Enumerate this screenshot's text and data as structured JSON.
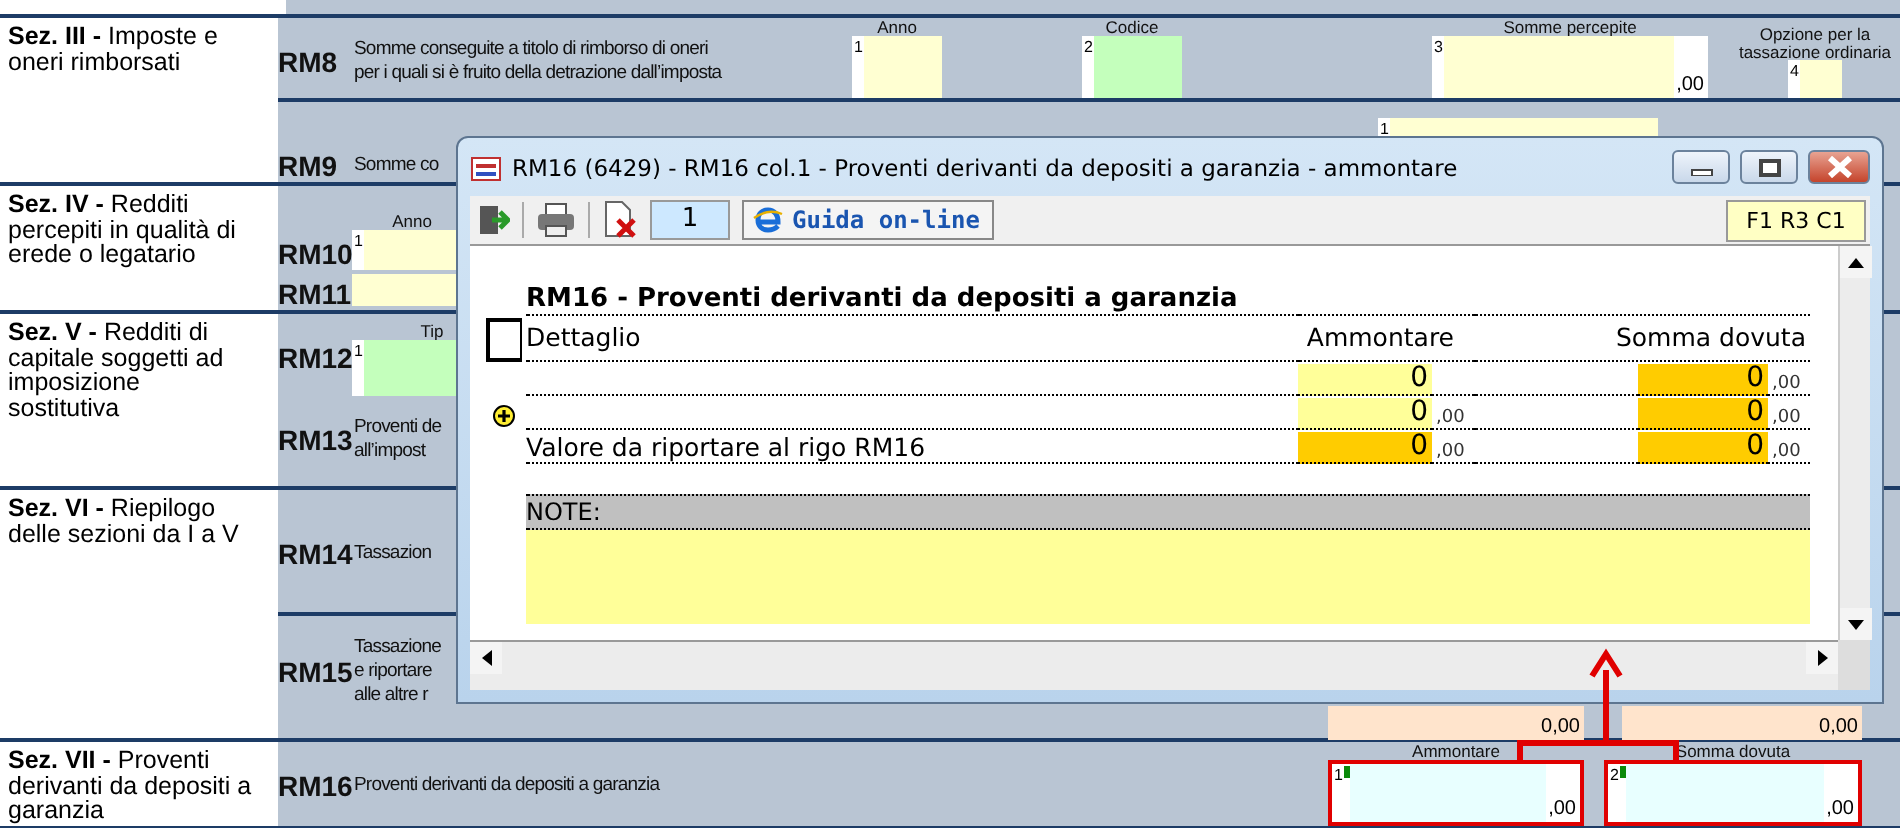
{
  "sections": [
    {
      "label": "**Sez. III -** Imposte e oneri rimborsati",
      "rows": [
        {
          "code": "RM8",
          "description": [
            "Somme conseguite a titolo di rimborso di oneri",
            "per i quali si è fruito della detrazione dall’imposta"
          ],
          "fields": [
            {
              "label": "Anno",
              "number": "1",
              "color": "#ffffd2"
            },
            {
              "label": "Codice",
              "number": "2",
              "color": "#c4ffbc"
            },
            {
              "label": "Somme percepite",
              "number": "3",
              "color": "#ffffd2",
              "decimals": ",00"
            },
            {
              "label": "Opzione per la tassazione ordinaria",
              "number": "4",
              "color": "#ffffd2"
            }
          ]
        },
        {
          "code": "RM9",
          "description": [
            "Somme co"
          ],
          "fields": [
            {
              "number": "1",
              "color": "#ffffd2"
            }
          ]
        }
      ]
    },
    {
      "label": "**Sez. IV -** Redditi percepiti in qualità di erede o legatario",
      "rows": [
        {
          "code": "RM10",
          "fields": [
            {
              "label": "Anno",
              "number": "1",
              "color": "#ffffd2"
            }
          ]
        },
        {
          "code": "RM11",
          "fields": [
            {
              "color": "#ffffd2"
            }
          ]
        }
      ]
    },
    {
      "label": "**Sez. V -** Redditi di capitale soggetti ad imposizione sostitutiva",
      "rows": [
        {
          "code": "RM12",
          "fields": [
            {
              "label": "Tip",
              "number": "1",
              "color": "#c4ffbc"
            }
          ]
        },
        {
          "code": "RM13",
          "description": [
            "Proventi de",
            "all’impost"
          ]
        }
      ]
    },
    {
      "label": "**Sez. VI -** Riepilogo delle sezioni da I a V",
      "rows": [
        {
          "code": "RM14",
          "description": [
            "Tassazion"
          ]
        },
        {
          "code": "RM15",
          "description": [
            "Tassazione",
            "e riportare",
            "alle altre r"
          ],
          "fields": [
            {
              "color": "#ffe4cc",
              "value": "0,00"
            },
            {
              "color": "#ffe4cc",
              "value": "0,00"
            }
          ]
        }
      ]
    },
    {
      "label": "**Sez. VII -** Proventi derivanti da depositi a garanzia",
      "rows": [
        {
          "code": "RM16",
          "description": [
            "Proventi derivanti da depositi a garanzia"
          ],
          "fields": [
            {
              "label": "Ammontare",
              "number": "1",
              "color": "#e8ffff",
              "decimals": ",00",
              "highlighted": true
            },
            {
              "label": "Somma dovuta",
              "number": "2",
              "color": "#e8ffff",
              "decimals": ",00",
              "highlighted": true
            }
          ]
        }
      ]
    }
  ],
  "dialog": {
    "title": "RM16 (6429) - RM16 col.1 - Proventi derivanti da depositi a garanzia - ammontare",
    "toolbar": {
      "page": "1",
      "help": "Guida on-line",
      "position": "F1 R3 C1"
    },
    "heading": "RM16 - Proventi derivanti da depositi a garanzia",
    "columns": [
      "Dettaglio",
      "Ammontare",
      "Somma dovuta"
    ],
    "rows": [
      {
        "amount": {
          "value": "0",
          "kind": "input"
        },
        "due": {
          "value": "0",
          "decimals": ",00",
          "kind": "computed"
        }
      },
      {
        "amount": {
          "value": "0",
          "decimals": ",00",
          "kind": "input"
        },
        "due": {
          "value": "0",
          "decimals": ",00",
          "kind": "computed"
        }
      },
      {
        "description": "Valore da riportare al rigo RM16",
        "amount": {
          "value": "0",
          "decimals": ",00",
          "kind": "computed"
        },
        "due": {
          "value": "0",
          "decimals": ",00",
          "kind": "computed"
        }
      }
    ],
    "notes": {
      "label": "NOTE:"
    }
  }
}
